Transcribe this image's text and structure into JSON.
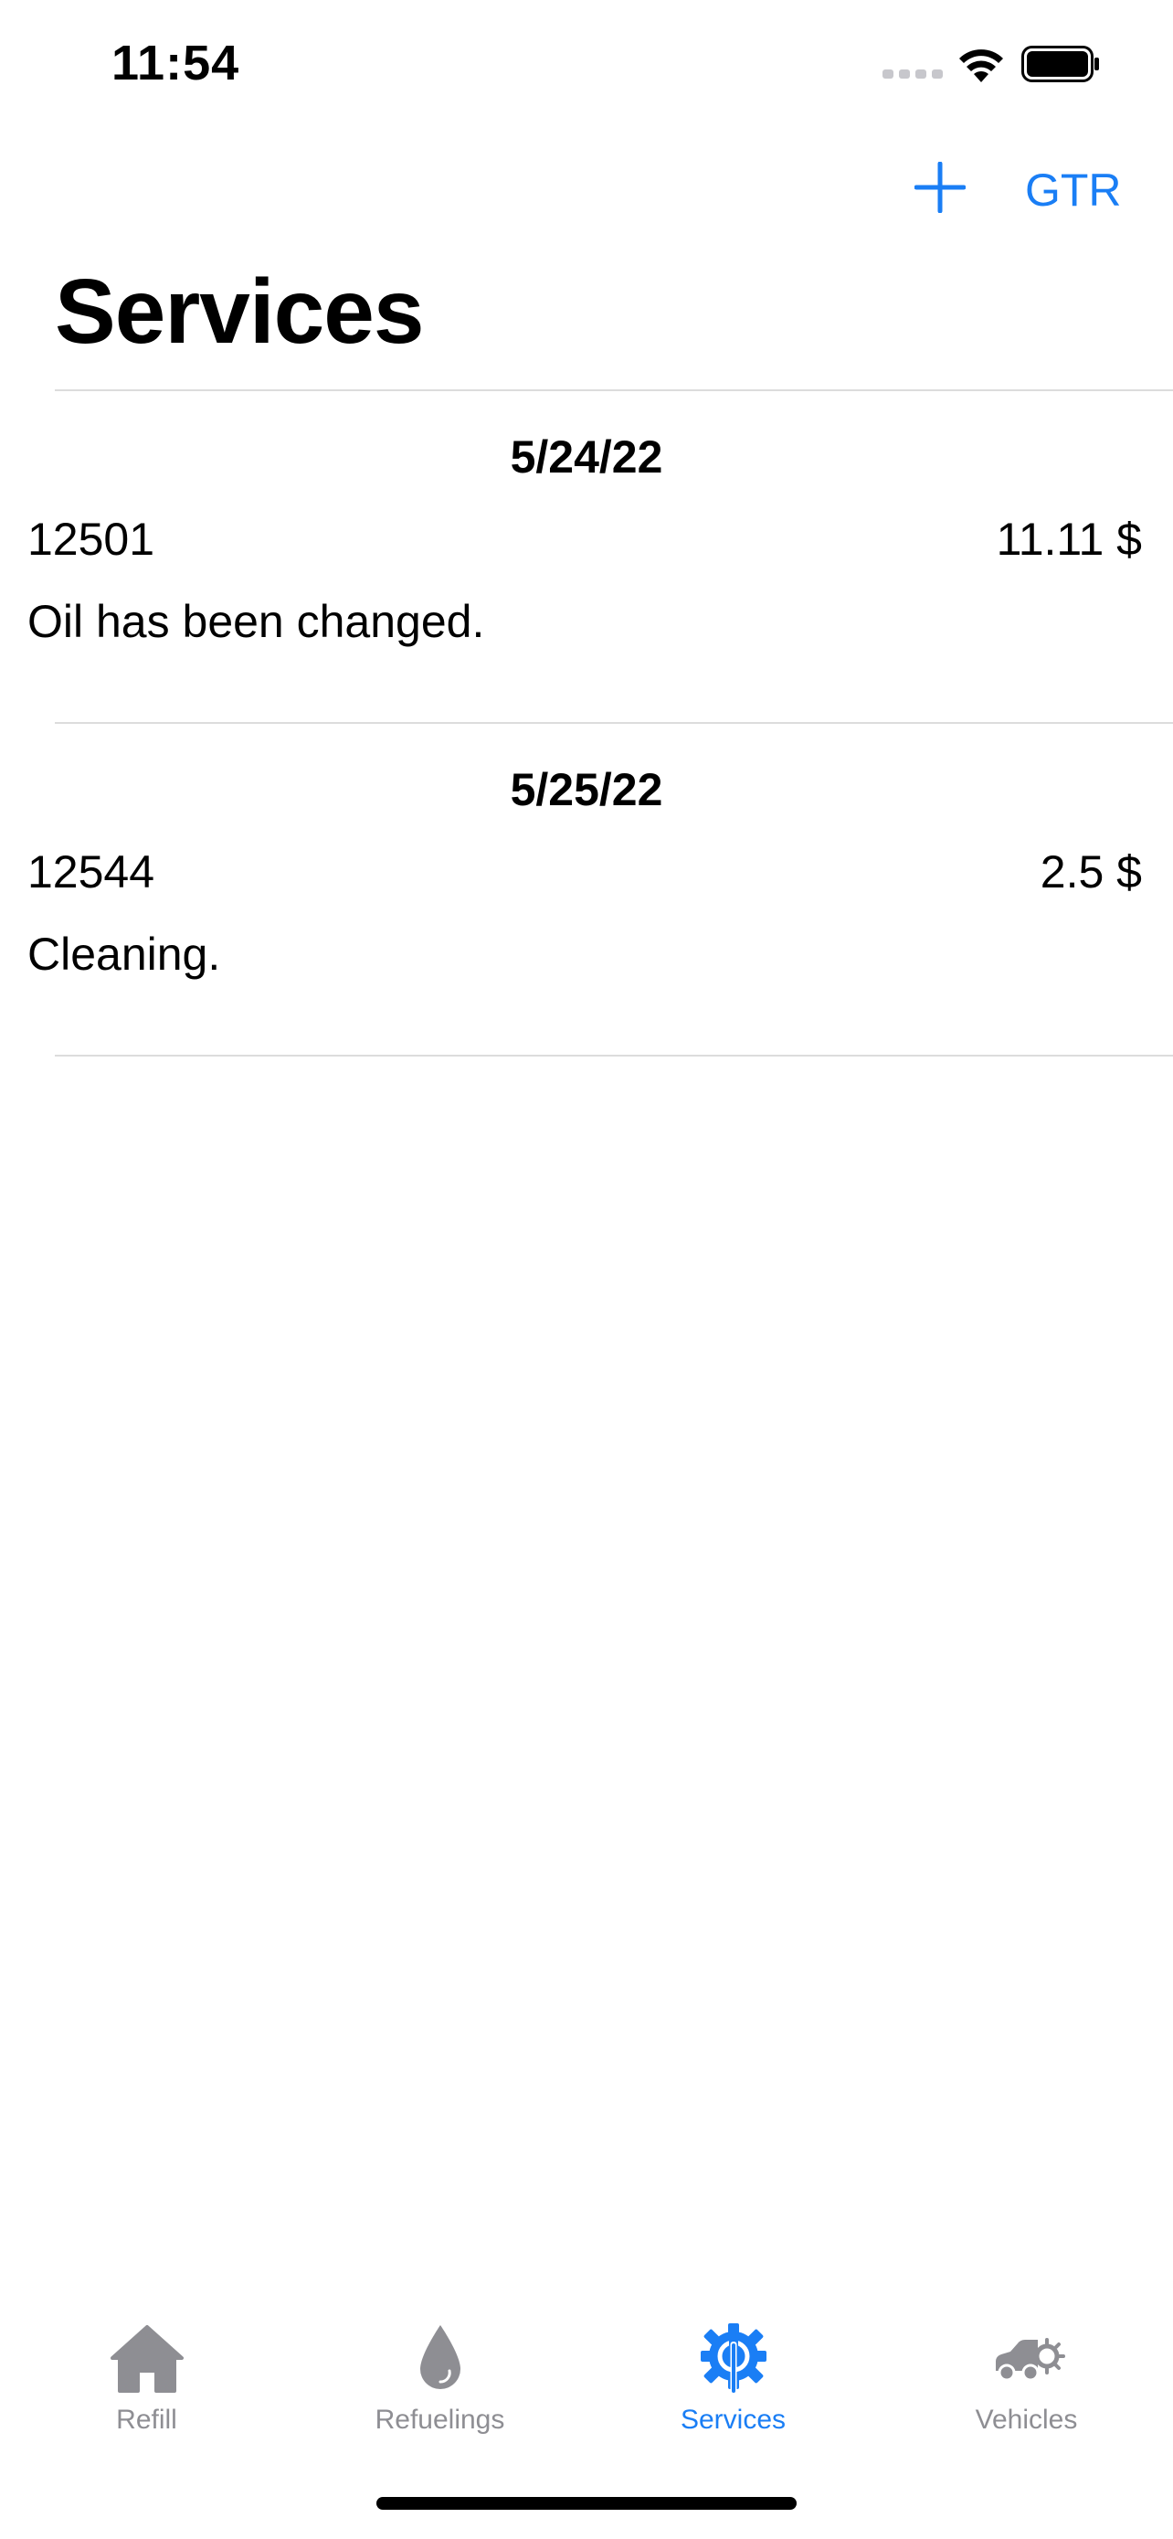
{
  "status_bar": {
    "time": "11:54"
  },
  "nav": {
    "add_icon": "plus-icon",
    "vehicle_label": "GTR"
  },
  "page": {
    "title": "Services"
  },
  "services": [
    {
      "date": "5/24/22",
      "odometer": "12501",
      "cost": "11.11 $",
      "note": "Oil has been changed."
    },
    {
      "date": "5/25/22",
      "odometer": "12544",
      "cost": "2.5 $",
      "note": "Cleaning."
    }
  ],
  "tabs": [
    {
      "label": "Refill",
      "icon": "house-icon",
      "active": false
    },
    {
      "label": "Refuelings",
      "icon": "drop-icon",
      "active": false
    },
    {
      "label": "Services",
      "icon": "gear-wrench-icon",
      "active": true
    },
    {
      "label": "Vehicles",
      "icon": "car-icon",
      "active": false
    }
  ],
  "colors": {
    "accent": "#1a7ef5",
    "inactive": "#8e8e93",
    "divider": "#dcdcdc"
  }
}
